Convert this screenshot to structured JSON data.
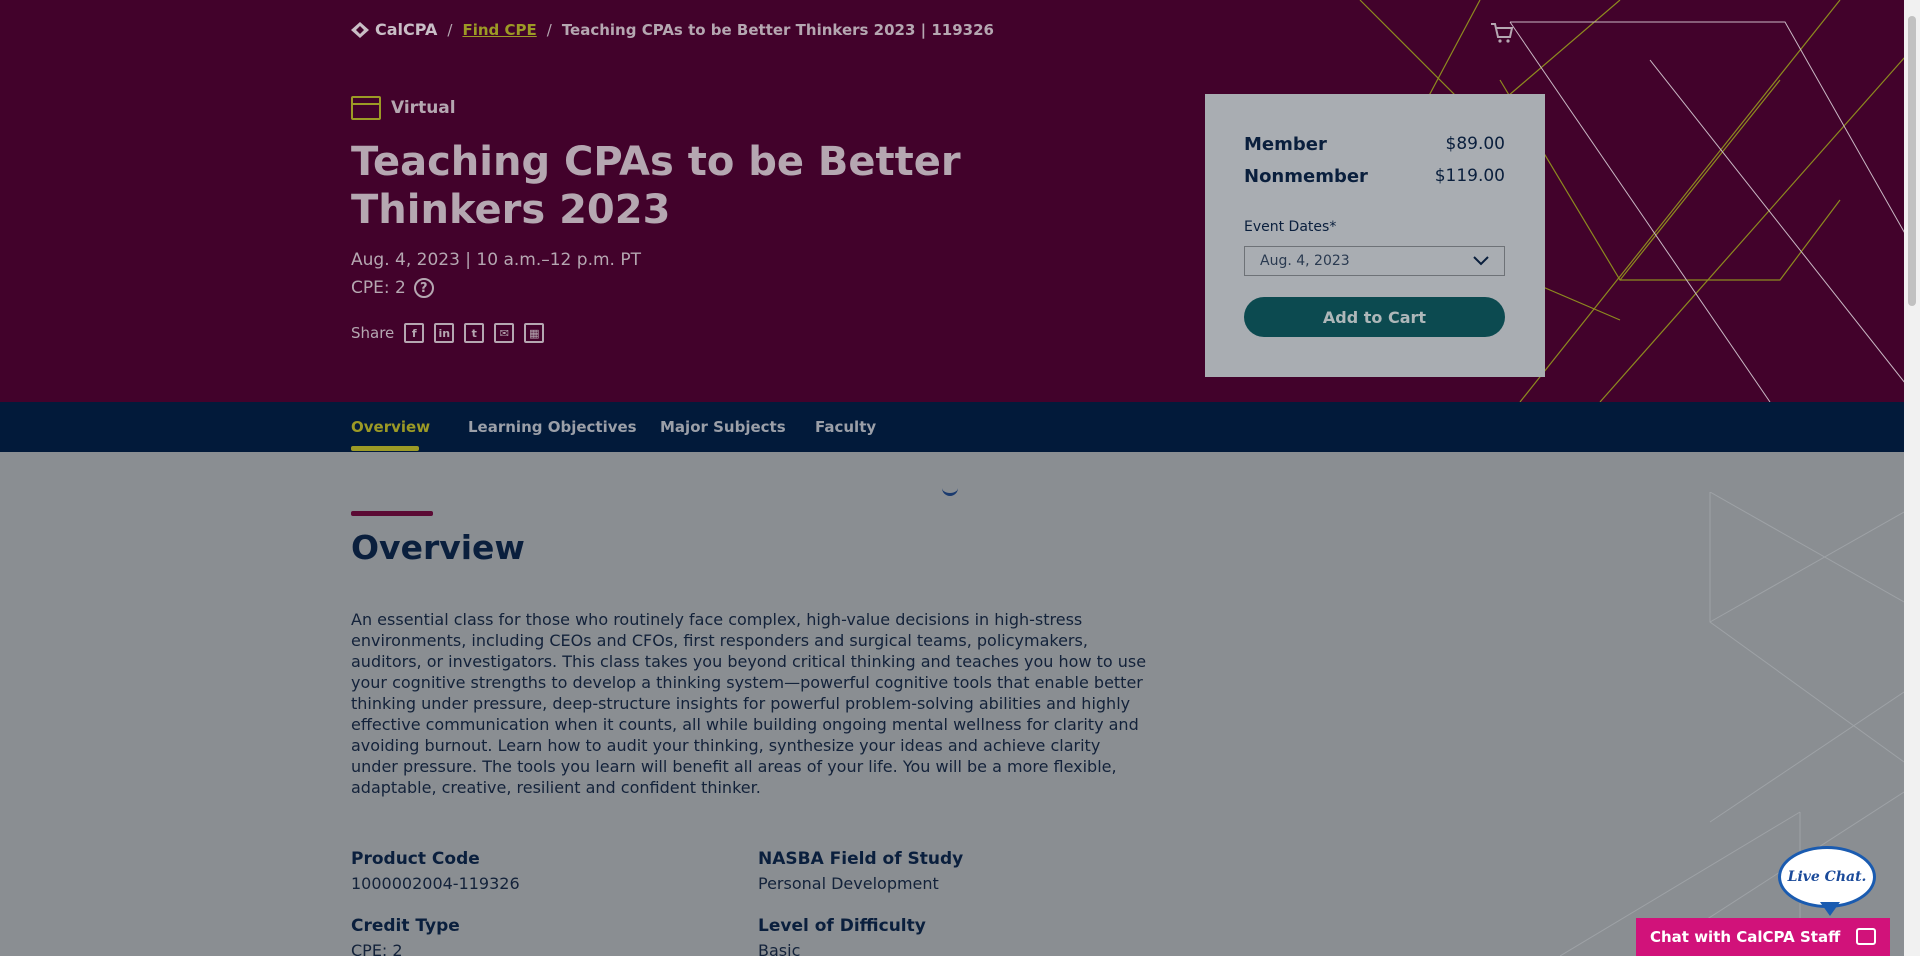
{
  "breadcrumb": {
    "logo": "CalCPA",
    "find_cpe": "Find CPE",
    "current": "Teaching CPAs to be Better Thinkers 2023 | 119326",
    "separator": "/"
  },
  "course": {
    "format": "Virtual",
    "title": "Teaching CPAs to be Better Thinkers 2023",
    "date": "Aug. 4, 2023 | 10 a.m.–12 p.m. PT",
    "cpe": "CPE: 2",
    "share_label": "Share"
  },
  "pricing": {
    "member_label": "Member",
    "member_price": "$89.00",
    "nonmember_label": "Nonmember",
    "nonmember_price": "$119.00",
    "event_dates_label": "Event Dates*",
    "event_date_selected": "Aug. 4, 2023",
    "add_to_cart": "Add to Cart"
  },
  "tabs": [
    "Overview",
    "Learning Objectives",
    "Major Subjects",
    "Faculty"
  ],
  "overview": {
    "heading": "Overview",
    "description": "An essential class for those who routinely face complex, high-value decisions in high-stress environments, including CEOs and CFOs, first responders and surgical teams, policymakers, auditors, or investigators. This class takes you beyond critical thinking and teaches you how to use your cognitive strengths to develop a thinking system—powerful cognitive tools that enable better thinking under pressure, deep-structure insights for powerful problem-solving abilities and highly effective communication when it counts, all while building ongoing mental wellness for clarity and avoiding burnout. Learn how to audit your thinking, synthesize your ideas and achieve clarity under pressure. The tools you learn will benefit all areas of your life. You will be a more flexible, adaptable, creative, resilient and confident thinker.",
    "product_code_label": "Product Code",
    "product_code": "1000002004-119326",
    "nasba_label": "NASBA Field of Study",
    "nasba_value": "Personal Development",
    "credit_type_label": "Credit Type",
    "credit_type_value": "CPE: 2",
    "difficulty_label": "Level of Difficulty",
    "difficulty_value": "Basic"
  },
  "chat": {
    "bubble": "Live Chat.",
    "bar": "Chat with CalCPA Staff"
  },
  "colors": {
    "hero_bg": "#42022b",
    "accent_olive": "#9c9a25",
    "nav_bg": "#021a3a",
    "button_teal": "#0c4a50",
    "chat_pink": "#d1127a"
  }
}
